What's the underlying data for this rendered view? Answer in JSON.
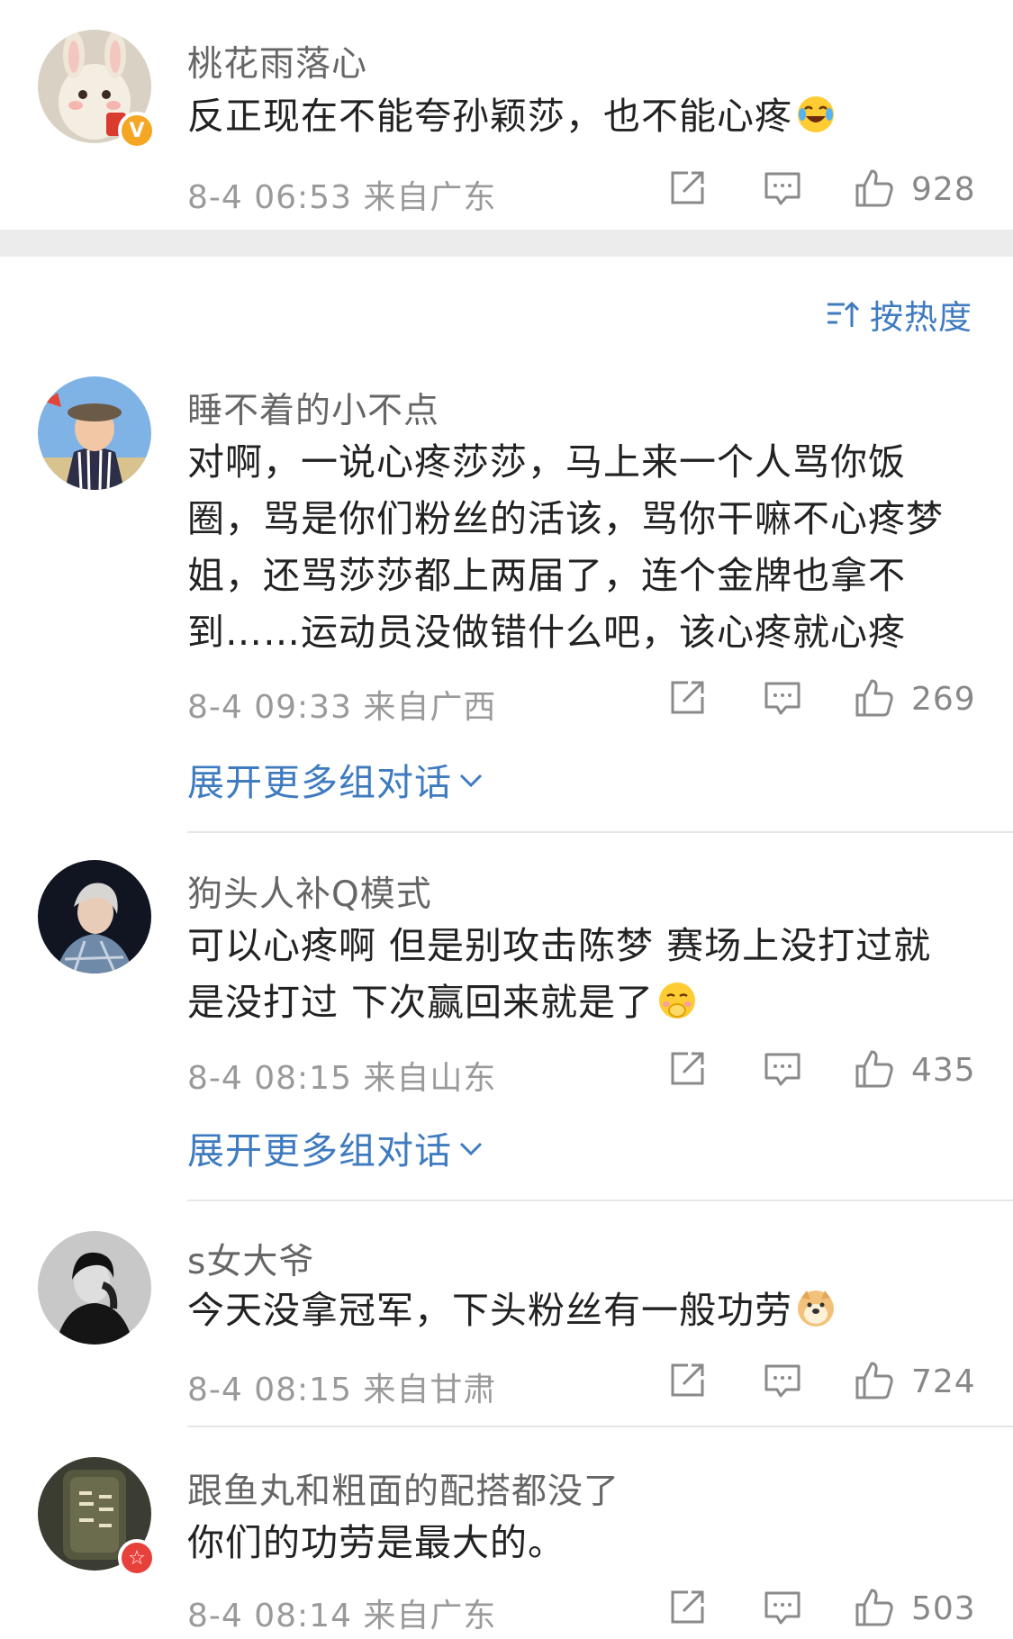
{
  "comments": [
    {
      "username": "桃花雨落心",
      "text": "反正现在不能夸孙颖莎，也不能心疼",
      "emoji": "laughing-tears-emoji",
      "meta": "8-4 06:53  来自广东",
      "likes": "928",
      "badge": "V"
    },
    {
      "username": "睡不着的小不点",
      "lines": [
        "对啊，一说心疼莎莎，马上来一个人骂你饭",
        "圈，骂是你们粉丝的活该，骂你干嘛不心疼梦",
        "姐，还骂莎莎都上两届了，连个金牌也拿不",
        "到……运动员没做错什么吧，该心疼就心疼"
      ],
      "meta": "8-4 09:33  来自广西",
      "likes": "269",
      "expand": "展开更多组对话"
    },
    {
      "username": "狗头人补Q模式",
      "lines": [
        "可以心疼啊 但是别攻击陈梦  赛场上没打过就",
        "是没打过 下次赢回来就是了"
      ],
      "emoji": "shushing-face-emoji",
      "meta": "8-4 08:15  来自山东",
      "likes": "435",
      "expand": "展开更多组对话"
    },
    {
      "username": "s女大爷",
      "text": "今天没拿冠军，下头粉丝有一般功劳",
      "emoji": "doge-emoji",
      "meta": "8-4 08:15  来自甘肃",
      "likes": "724"
    },
    {
      "username": "跟鱼丸和粗面的配搭都没了",
      "text": "你们的功劳是最大的。",
      "meta": "8-4 08:14  来自广东",
      "likes": "503",
      "badge": "☆"
    }
  ],
  "sort": {
    "label": "按热度",
    "icon": "sort-icon"
  },
  "colors": {
    "link": "#3f7bbf",
    "meta": "#9a9a9a",
    "band": "#ececec",
    "vip_badge": "#f5a623",
    "red_badge": "#e8403a"
  }
}
